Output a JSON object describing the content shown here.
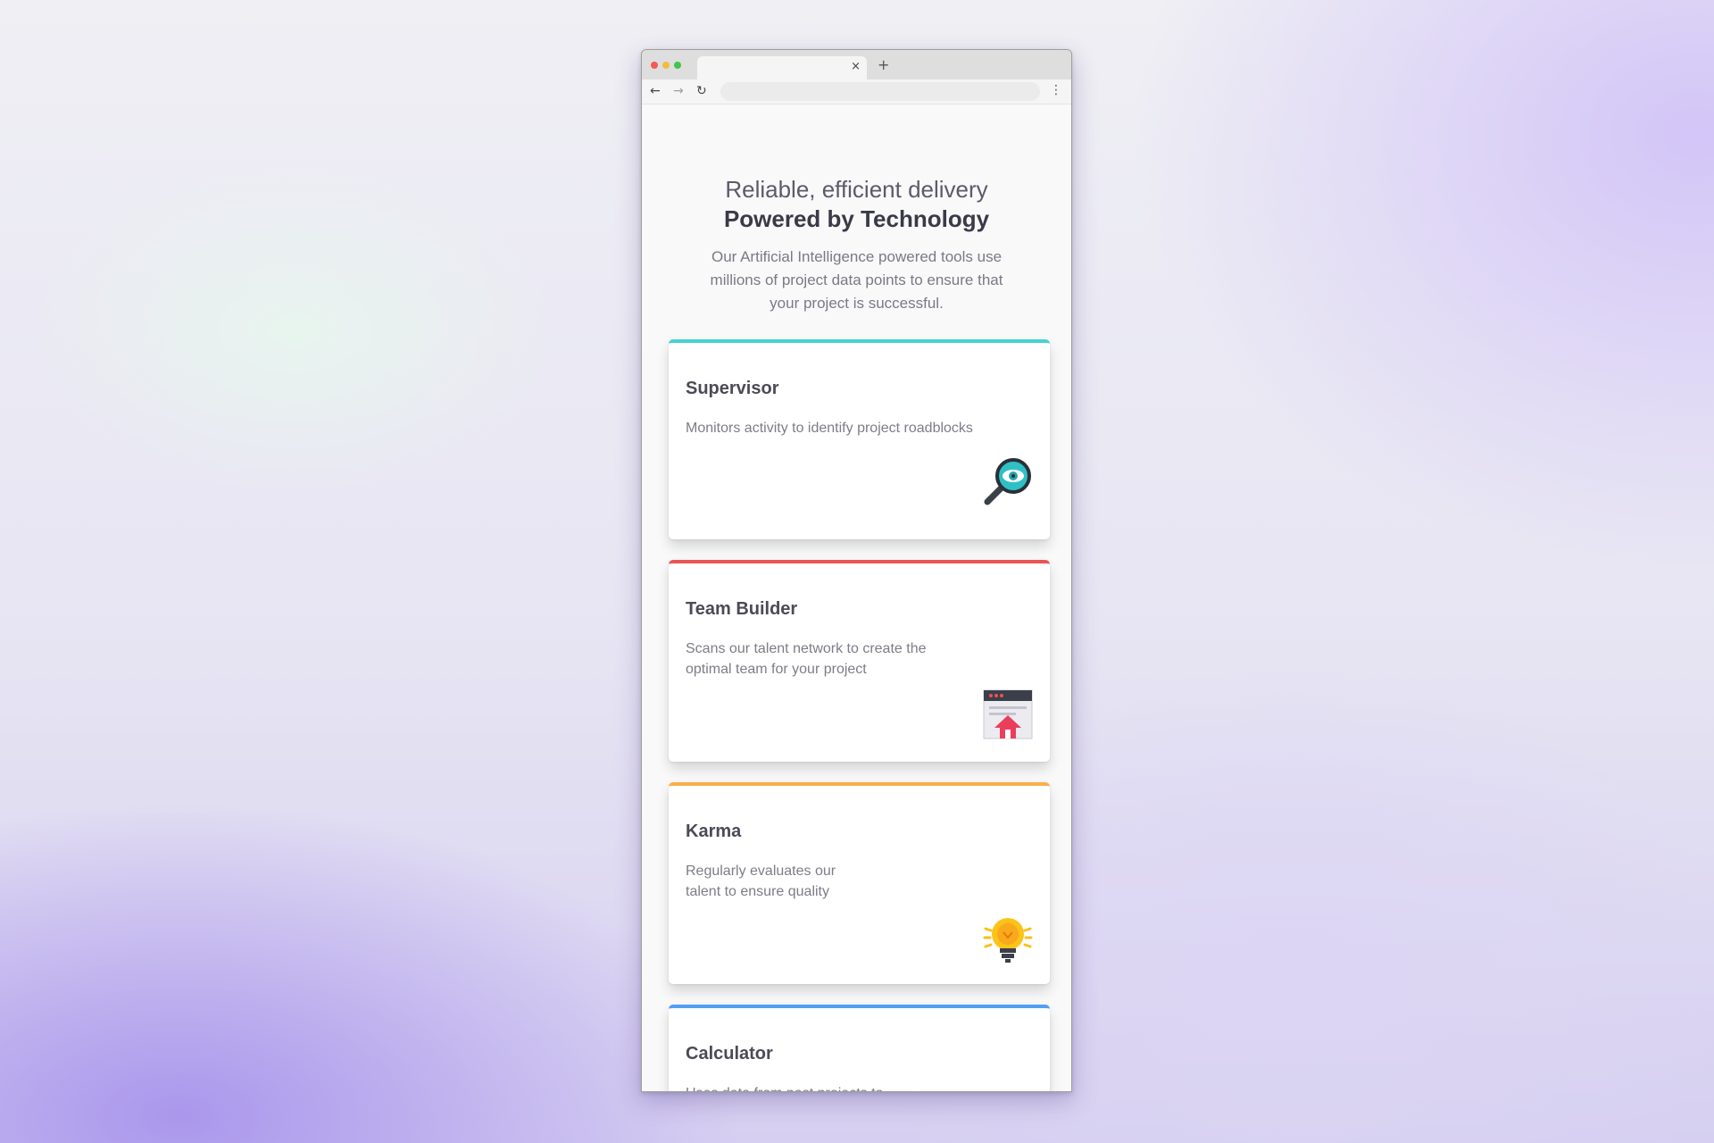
{
  "browser": {
    "tab_close": "×",
    "new_tab": "+",
    "address_value": "",
    "back_glyph": "←",
    "forward_glyph": "→",
    "reload_glyph": "↻",
    "menu_glyph": "⋮"
  },
  "hero": {
    "line1": "Reliable, efficient delivery",
    "line2": "Powered by Technology",
    "description": "Our Artificial Intelligence powered tools use millions of project data points to ensure that your project is successful."
  },
  "cards": [
    {
      "title": "Supervisor",
      "description": "Monitors activity to identify project roadblocks",
      "accent": "#44d3d0",
      "icon": "magnifier-eye-icon"
    },
    {
      "title": "Team Builder",
      "description": "Scans our talent network to create the optimal team for your project",
      "accent": "#ea5454",
      "icon": "browser-upload-icon"
    },
    {
      "title": "Karma",
      "description": "Regularly evaluates our talent to ensure quality",
      "accent": "#fcae4a",
      "icon": "lightbulb-icon"
    },
    {
      "title": "Calculator",
      "description": "Uses data from past projects to",
      "accent": "#549ef2",
      "icon": "calculator-icon"
    }
  ]
}
